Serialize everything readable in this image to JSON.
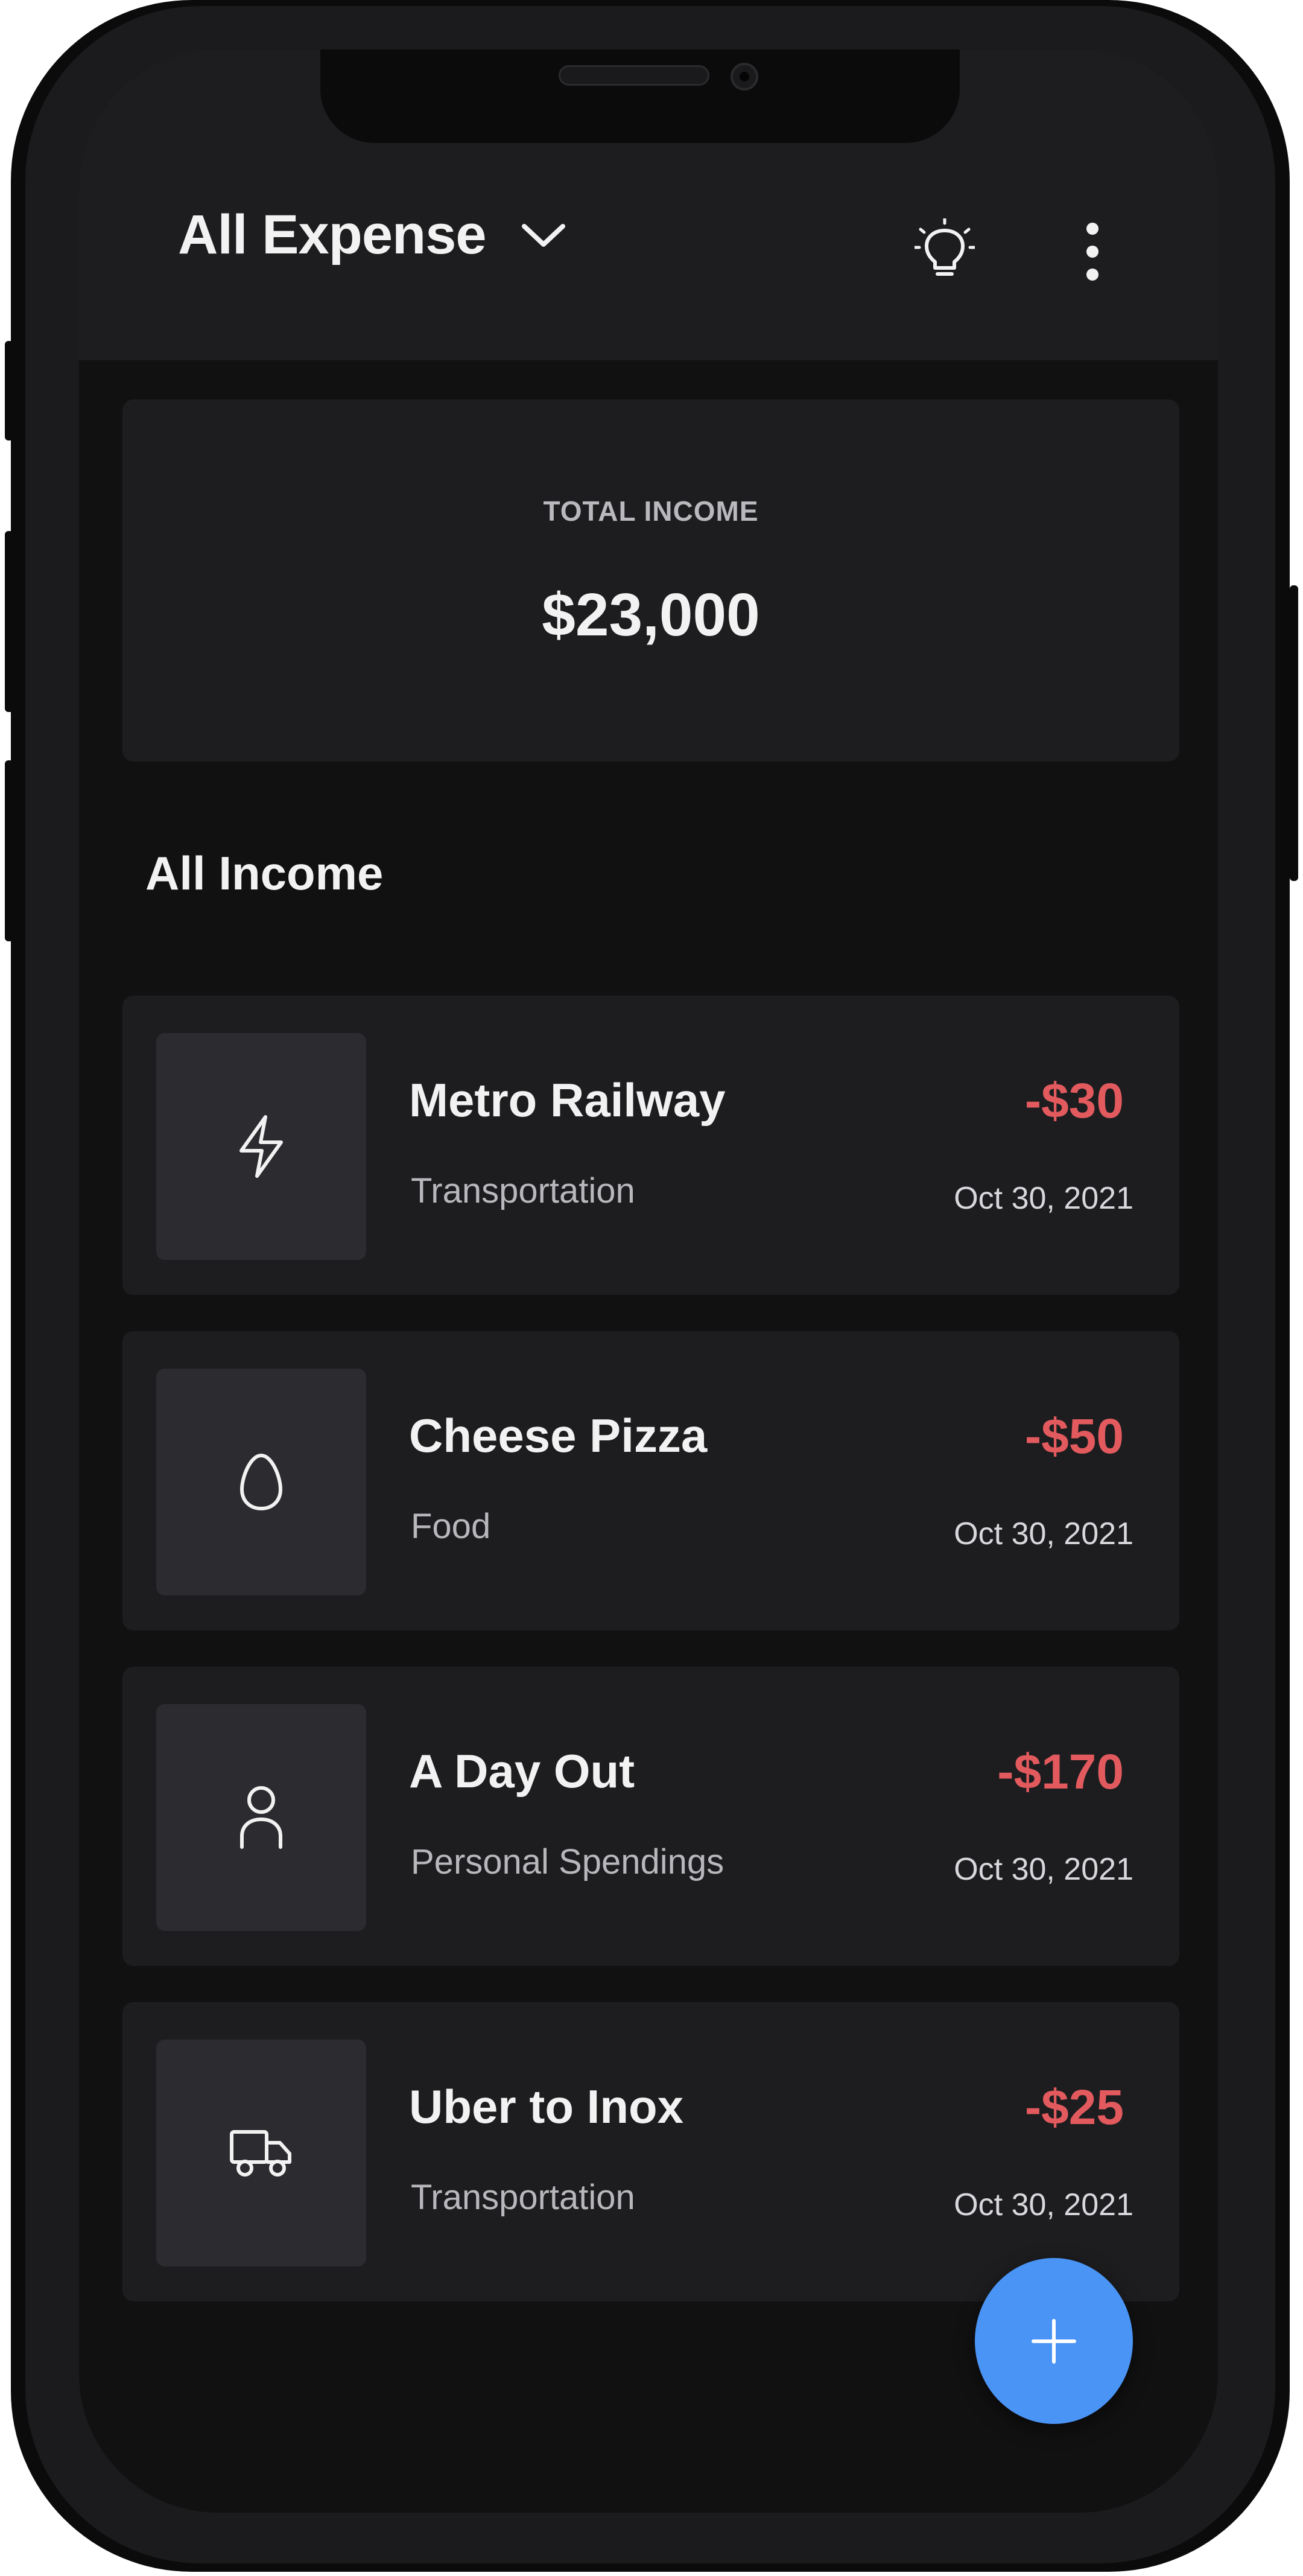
{
  "header": {
    "title": "All Expense",
    "dropdown_icon": "chevron-down-icon",
    "idea_icon": "lightbulb-icon",
    "menu_icon": "more-vertical-icon"
  },
  "summary": {
    "label": "TOTAL INCOME",
    "value": "$23,000"
  },
  "section": {
    "title": "All Income"
  },
  "transactions": [
    {
      "title": "Metro Railway",
      "category": "Transportation",
      "amount": "-$30",
      "date": "Oct 30, 2021",
      "icon": "lightning-icon"
    },
    {
      "title": "Cheese Pizza",
      "category": "Food",
      "amount": "-$50",
      "date": "Oct 30, 2021",
      "icon": "egg-icon"
    },
    {
      "title": "A Day Out",
      "category": "Personal Spendings",
      "amount": "-$170",
      "date": "Oct 30, 2021",
      "icon": "person-icon"
    },
    {
      "title": "Uber to Inox",
      "category": "Transportation",
      "amount": "-$25",
      "date": "Oct 30, 2021",
      "icon": "truck-icon"
    }
  ],
  "fab": {
    "icon": "plus-icon"
  },
  "colors": {
    "background": "#111112",
    "card": "#1d1d20",
    "icon_tile": "#2c2c30",
    "expense_red": "#e25a5d",
    "accent_blue": "#4a94f5"
  }
}
